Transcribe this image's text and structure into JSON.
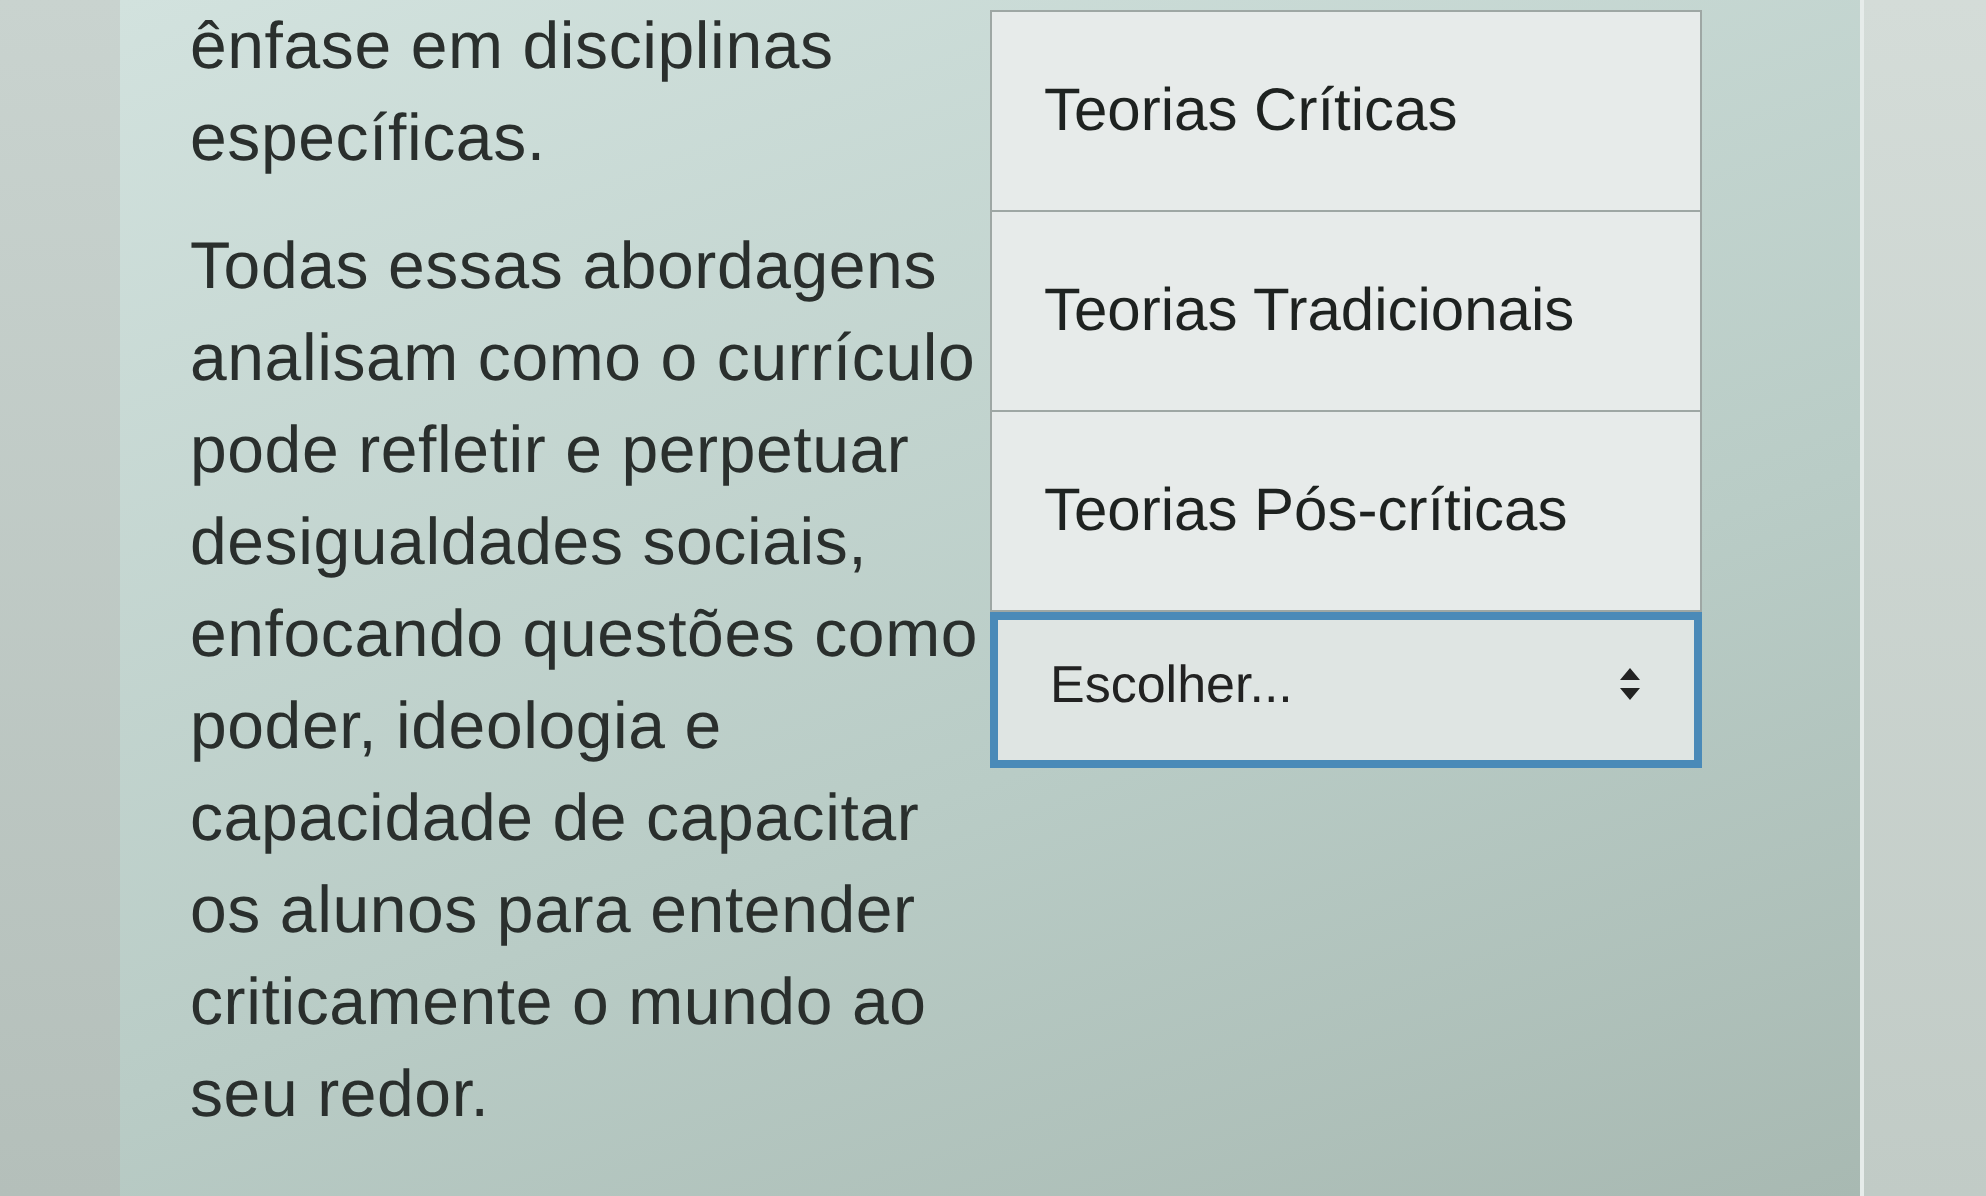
{
  "paragraphs": [
    "ênfase em disciplinas específicas.",
    "Todas essas abordagens analisam como o currículo pode refletir e perpetuar desigualdades sociais, enfocando questões como poder, ideologia e capacidade de capacitar os alunos para entender criticamente o mundo ao seu redor."
  ],
  "select": {
    "value": "Escolher...",
    "expanded": true,
    "options": [
      {
        "label": "Teorias Críticas",
        "selected": false
      },
      {
        "label": "Teorias Tradicionais",
        "selected": false
      },
      {
        "label": "Teorias Pós-críticas",
        "selected": false
      }
    ]
  }
}
